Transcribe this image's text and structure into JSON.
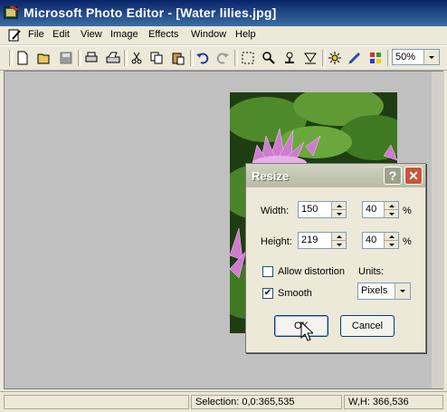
{
  "window": {
    "title": "Microsoft Photo Editor - [Water lilies.jpg]"
  },
  "menu": {
    "items": [
      "File",
      "Edit",
      "View",
      "Image",
      "Effects",
      "Window",
      "Help"
    ]
  },
  "toolbar": {
    "icons": [
      "new-icon",
      "open-icon",
      "save-icon",
      "print-icon",
      "scan-icon",
      "cut-icon",
      "copy-icon",
      "paste-icon",
      "undo-icon",
      "redo-icon",
      "select-icon",
      "zoom-icon",
      "stamp-icon",
      "smudge-icon",
      "brightness-icon",
      "pen-icon",
      "color-icon"
    ],
    "zoom_value": "50%"
  },
  "status": {
    "selection": "Selection: 0,0:365,535",
    "size": "W,H: 366,536"
  },
  "dialog": {
    "title": "Resize",
    "help_label": "?",
    "close_label": "✕",
    "width_label": "Width:",
    "width_value": "150",
    "width_percent": "40",
    "height_label": "Height:",
    "height_value": "219",
    "height_percent": "40",
    "percent_sign": "%",
    "allow_distortion_label": "Allow distortion",
    "allow_distortion_checked": false,
    "smooth_label": "Smooth",
    "smooth_checked": true,
    "units_label": "Units:",
    "units_value": "Pixels",
    "ok_label": "OK",
    "cancel_label": "Cancel"
  },
  "colors": {
    "titlebar": "#0a246a",
    "workspace": "#c0c0c0",
    "leaf": "#4e8a2a",
    "lily": "#d07ad0"
  }
}
